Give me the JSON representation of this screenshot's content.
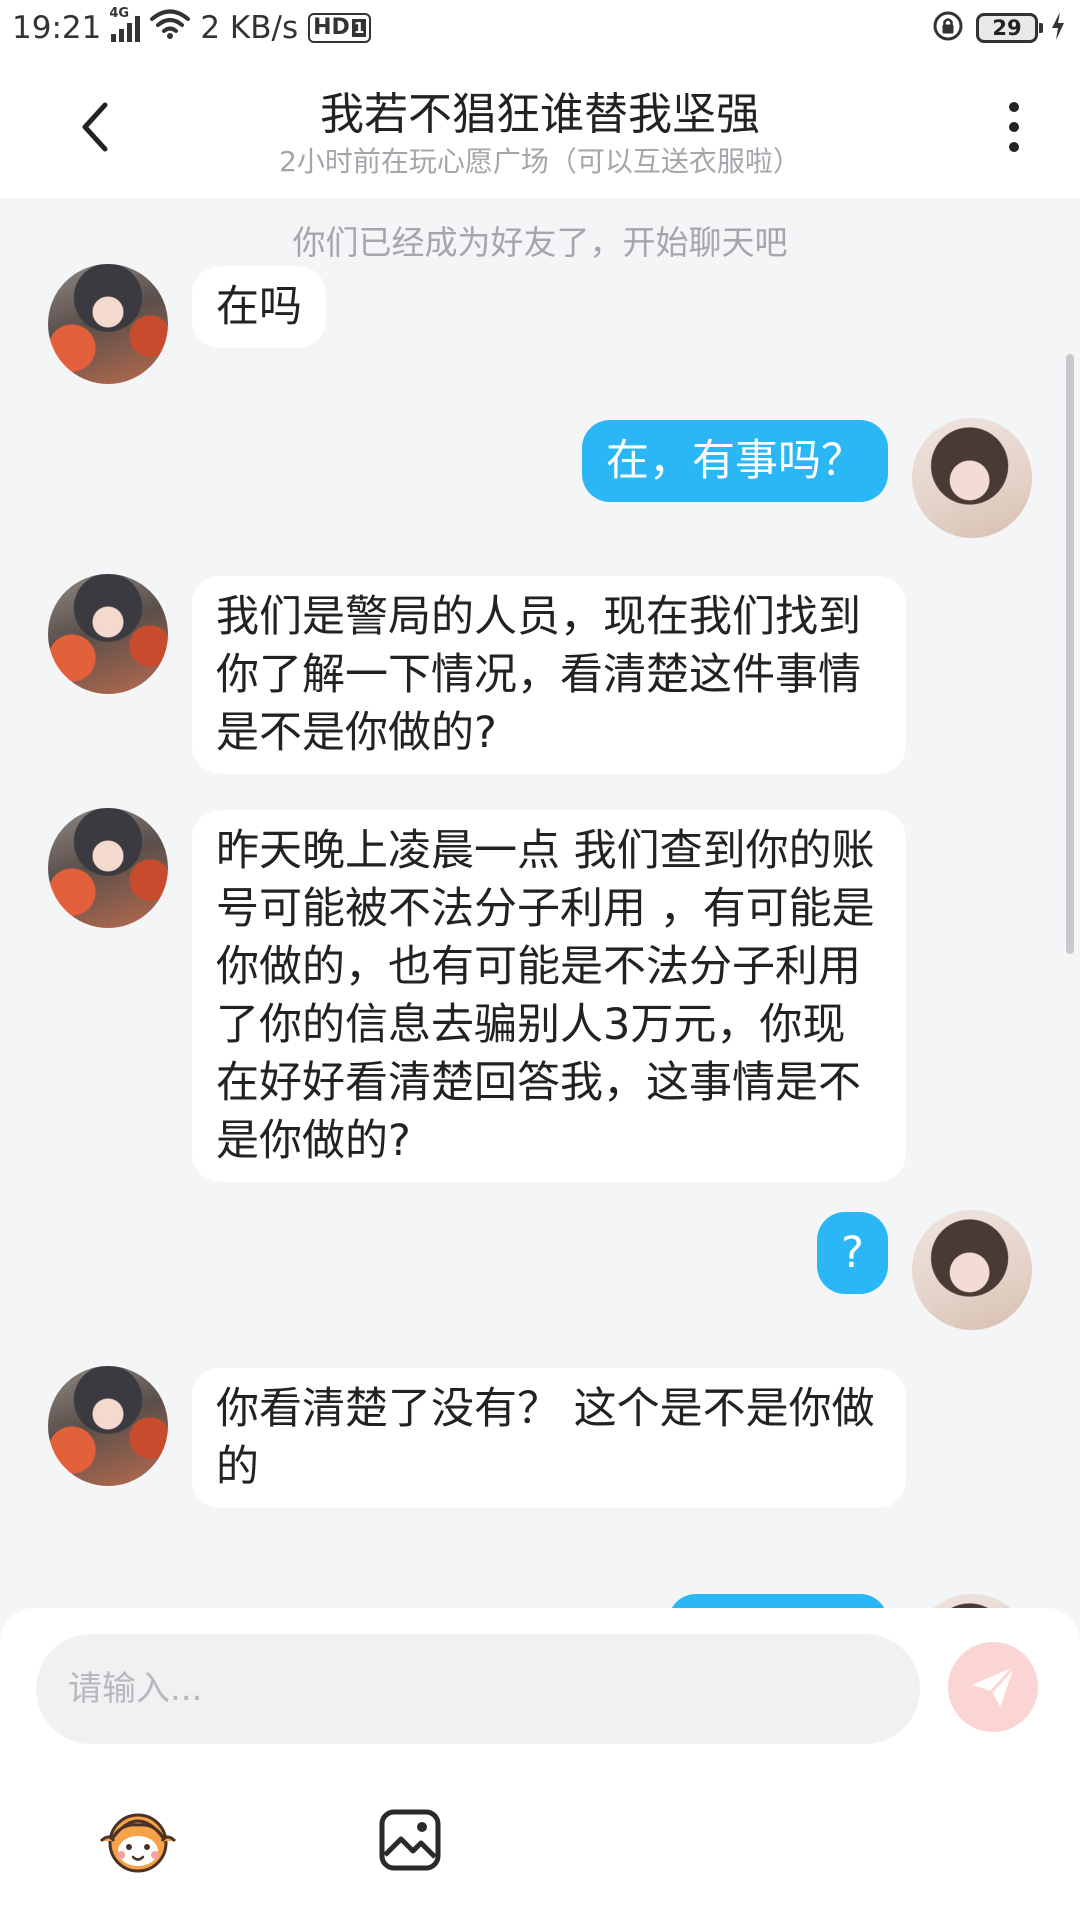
{
  "status_bar": {
    "time": "19:21",
    "network_type": "4G",
    "speed": "2 KB/s",
    "hd_label": "HD",
    "hd_sim": "1",
    "battery": "29"
  },
  "header": {
    "title": "我若不猖狂谁替我坚强",
    "subtitle": "2小时前在玩心愿广场（可以互送衣服啦）"
  },
  "chat": {
    "system_note": "你们已经成为好友了，开始聊天吧",
    "messages": [
      {
        "side": "left",
        "text": "在吗"
      },
      {
        "side": "right",
        "text": "在，有事吗？"
      },
      {
        "side": "left",
        "text": "我们是警局的人员，现在我们找到你了解一下情况，看清楚这件事情是不是你做的?"
      },
      {
        "side": "left",
        "text": "昨天晚上凌晨一点 我们查到你的账号可能被不法分子利用 ，有可能是你做的，也有可能是不法分子利用了你的信息去骗别人3万元，你现在好好看清楚回答我，这事情是不是你做的?"
      },
      {
        "side": "right",
        "text": "?"
      },
      {
        "side": "left",
        "text": "你看清楚了没有？ 这个是不是你做的"
      }
    ]
  },
  "input": {
    "placeholder": "请输入..."
  },
  "icons": {
    "back": "chevron-left-icon",
    "more": "more-vertical-icon",
    "send": "send-icon",
    "emoji": "emoji-face-icon",
    "image": "image-icon",
    "lock": "rotation-lock-icon",
    "charging": "charging-icon"
  },
  "colors": {
    "accent_blue": "#2bb7f6",
    "background": "#f4f5f7",
    "send_button": "#fbd5d4",
    "muted_text": "#a4a6ab"
  }
}
